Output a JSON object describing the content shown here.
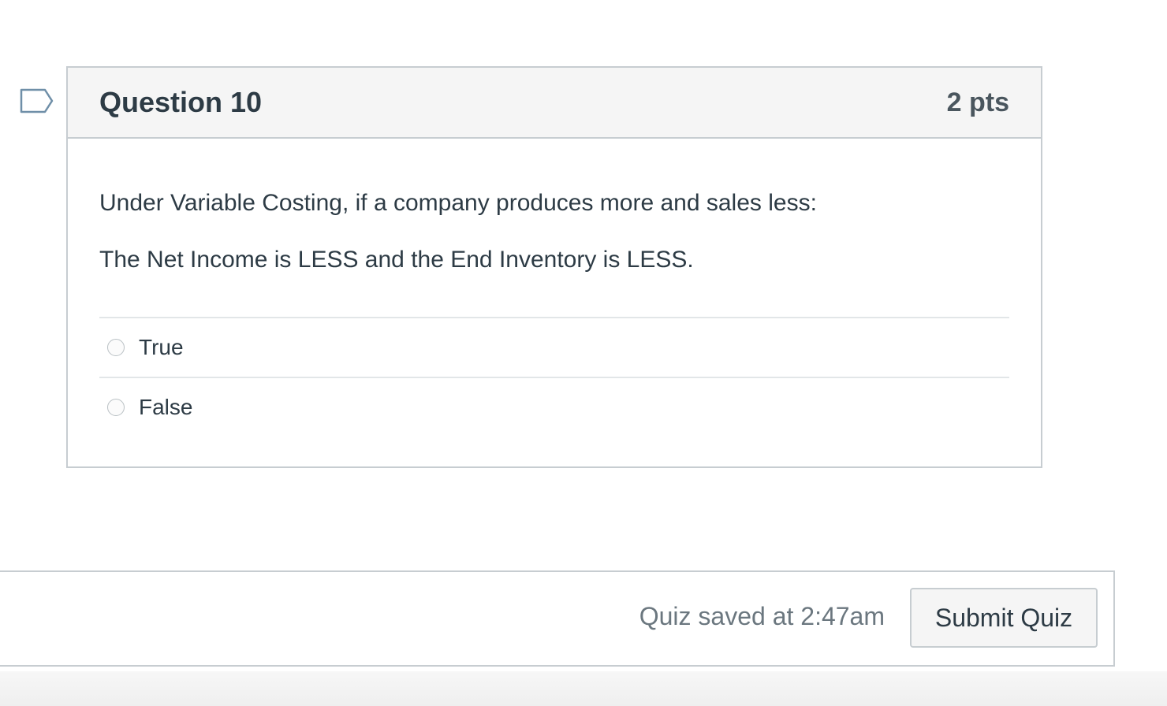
{
  "question": {
    "title": "Question 10",
    "points": "2 pts",
    "text_lines": [
      "Under Variable Costing, if a company produces more and sales less:",
      "The Net Income is LESS and the End Inventory is LESS."
    ],
    "answers": [
      {
        "label": "True",
        "selected": false
      },
      {
        "label": "False",
        "selected": false
      }
    ],
    "flag_icon": "bookmark-flag-icon"
  },
  "footer": {
    "saved_status": "Quiz saved at 2:47am",
    "submit_label": "Submit Quiz"
  },
  "colors": {
    "border": "#c7cdd1",
    "header_bg": "#f5f5f5",
    "text": "#2d3b45",
    "flag_stroke": "#6f8fa8"
  }
}
